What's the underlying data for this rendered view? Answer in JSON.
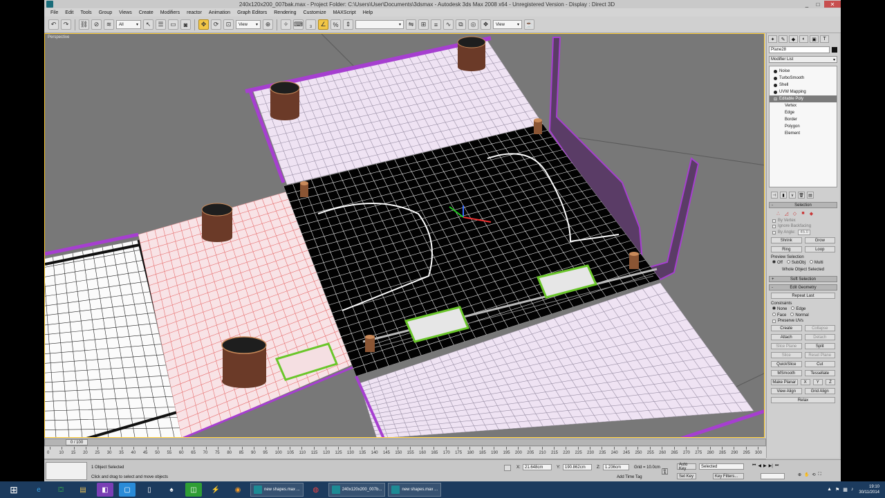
{
  "window": {
    "title": "240x120x200_007bak.max   -   Project Folder: C:\\Users\\User\\Documents\\3dsmax   -   Autodesk 3ds Max 2008 x64   -   Unregistered Version   -   Display : Direct 3D",
    "minimize": "_",
    "maximize": "□",
    "close": "✕"
  },
  "menu": [
    "File",
    "Edit",
    "Tools",
    "Group",
    "Views",
    "Create",
    "Modifiers",
    "reactor",
    "Animation",
    "Graph Editors",
    "Rendering",
    "Customize",
    "MAXScript",
    "Help"
  ],
  "toolbar": {
    "selection_filter": "All",
    "ref_coord": "View",
    "named_selection": "",
    "view_dropdown": "View",
    "icons": [
      "undo-icon",
      "redo-icon",
      "link-icon",
      "unlink-icon",
      "bind-icon"
    ]
  },
  "viewport": {
    "label": "Perspective",
    "bg": "#787878"
  },
  "command_panel": {
    "tabs": [
      "✦",
      "✎",
      "◆",
      "◐",
      "▣",
      "T"
    ],
    "object_name": "Plane28",
    "object_color": "#111111",
    "modifier_list": "Modifier List",
    "stack": [
      {
        "label": "Noise",
        "type": "mod"
      },
      {
        "label": "TurboSmooth",
        "type": "mod"
      },
      {
        "label": "Shell",
        "type": "mod"
      },
      {
        "label": "UVW Mapping",
        "type": "mod"
      },
      {
        "label": "Editable Poly",
        "type": "base"
      },
      {
        "label": "Vertex",
        "type": "sub"
      },
      {
        "label": "Edge",
        "type": "sub"
      },
      {
        "label": "Border",
        "type": "sub"
      },
      {
        "label": "Polygon",
        "type": "sub"
      },
      {
        "label": "Element",
        "type": "sub"
      }
    ],
    "selection_rollout": "Selection",
    "by_vertex": "By Vertex",
    "ignore_backfacing": "Ignore Backfacing",
    "by_angle": "By Angle:",
    "by_angle_value": "45.0",
    "shrink": "Shrink",
    "grow": "Grow",
    "ring": "Ring",
    "loop": "Loop",
    "preview_selection": "Preview Selection",
    "preview_off": "Off",
    "preview_subobj": "SubObj",
    "preview_multi": "Multi",
    "status": "Whole Object Selected",
    "soft_selection": "Soft Selection",
    "edit_geometry": "Edit Geometry",
    "repeat_last": "Repeat Last",
    "constraints": "Constraints",
    "c_none": "None",
    "c_edge": "Edge",
    "c_face": "Face",
    "c_normal": "Normal",
    "preserve_uvs": "Preserve UVs",
    "create": "Create",
    "collapse": "Collapse",
    "attach": "Attach",
    "detach": "Detach",
    "slice_plane": "Slice Plane",
    "split": "Split",
    "slice": "Slice",
    "reset_plane": "Reset Plane",
    "quickslice": "QuickSlice",
    "cut": "Cut",
    "msmooth": "MSmooth",
    "tessellate": "Tessellate",
    "make_planar": "Make Planar",
    "x": "X",
    "y": "Y",
    "z": "Z",
    "view_align": "View Align",
    "grid_align": "Grid Align",
    "relax": "Relax"
  },
  "timeline": {
    "slider": "0 / 100",
    "ticks": [
      "0",
      "10",
      "15",
      "20",
      "25",
      "30",
      "35",
      "40",
      "45",
      "50",
      "55",
      "60",
      "65",
      "70",
      "75",
      "80",
      "85",
      "90",
      "95",
      "100",
      "105",
      "110",
      "115",
      "120",
      "125",
      "130",
      "135",
      "140",
      "145",
      "150",
      "155",
      "160",
      "165",
      "170",
      "175",
      "180",
      "185",
      "190",
      "195",
      "200",
      "205",
      "210",
      "215",
      "220",
      "225",
      "230",
      "235",
      "240",
      "245",
      "250",
      "255",
      "260",
      "265",
      "270",
      "275",
      "280",
      "285",
      "290",
      "295",
      "300"
    ]
  },
  "status": {
    "objects_selected": "1 Object Selected",
    "prompt": "Click and drag to select and move objects",
    "x_label": "X:",
    "x_value": "21.648cm",
    "y_label": "Y:",
    "y_value": "190.862cm",
    "z_label": "Z:",
    "z_value": "1.236cm",
    "grid": "Grid = 10.0cm",
    "add_time_tag": "Add Time Tag",
    "auto_key": "Auto Key",
    "selected": "Selected",
    "set_key": "Set Key",
    "key_filters": "Key Filters..."
  },
  "taskbar": {
    "tasks": [
      {
        "label": "new shapes.max ..."
      },
      {
        "label": "240x120x200_007b..."
      },
      {
        "label": "new shapes.max ..."
      }
    ],
    "time": "19:10",
    "date": "30/11/2014"
  }
}
